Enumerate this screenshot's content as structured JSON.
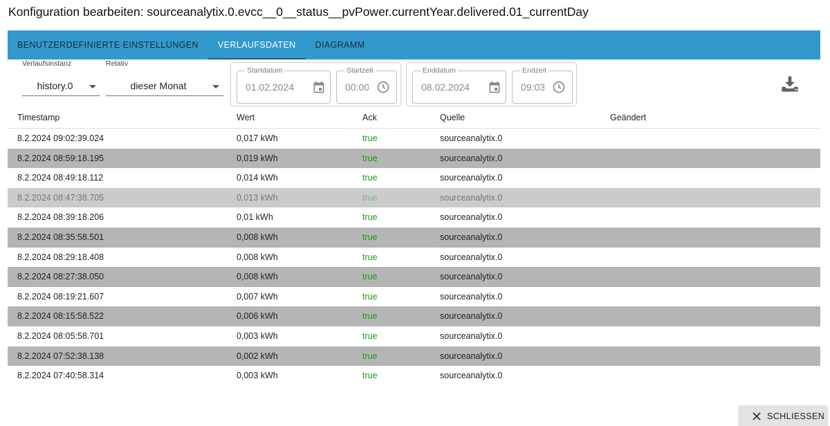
{
  "dialog": {
    "title": "Konfiguration bearbeiten: sourceanalytix.0.evcc__0__status__pvPower.currentYear.delivered.01_currentDay",
    "close_label": "SCHLIESSEN"
  },
  "tabs": [
    {
      "label": "BENUTZERDEFINIERTE EINSTELLUNGEN",
      "active": false
    },
    {
      "label": "VERLAUFSDATEN",
      "active": true
    },
    {
      "label": "DIAGRAMM",
      "active": false
    }
  ],
  "filters": {
    "instance": {
      "label": "Verlaufsinstanz",
      "value": "history.0"
    },
    "relative": {
      "label": "Relativ",
      "value": "dieser Monat"
    },
    "start_date": {
      "label": "Startdatum",
      "value": "01.02.2024"
    },
    "start_time": {
      "label": "Startzeit",
      "value": "00:00"
    },
    "end_date": {
      "label": "Enddatum",
      "value": "08.02.2024"
    },
    "end_time": {
      "label": "Endzeit",
      "value": "09:03"
    }
  },
  "table": {
    "columns": [
      "Timestamp",
      "Wert",
      "Ack",
      "Quelle",
      "Geändert"
    ],
    "rows": [
      {
        "timestamp": "8.2.2024 09:02:39.024",
        "value": "0,017 kWh",
        "ack": "true",
        "source": "sourceanalytix.0",
        "changed": ""
      },
      {
        "timestamp": "8.2.2024 08:59:18.195",
        "value": "0,019 kWh",
        "ack": "true",
        "source": "sourceanalytix.0",
        "changed": ""
      },
      {
        "timestamp": "8.2.2024 08:49:18.112",
        "value": "0,014 kWh",
        "ack": "true",
        "source": "sourceanalytix.0",
        "changed": ""
      },
      {
        "timestamp": "8.2.2024 08:47:38.705",
        "value": "0,013 kWh",
        "ack": "true",
        "source": "sourceanalytix.0",
        "changed": "",
        "highlighted": true
      },
      {
        "timestamp": "8.2.2024 08:39:18.206",
        "value": "0,01 kWh",
        "ack": "true",
        "source": "sourceanalytix.0",
        "changed": ""
      },
      {
        "timestamp": "8.2.2024 08:35:58.501",
        "value": "0,008 kWh",
        "ack": "true",
        "source": "sourceanalytix.0",
        "changed": ""
      },
      {
        "timestamp": "8.2.2024 08:29:18.408",
        "value": "0,008 kWh",
        "ack": "true",
        "source": "sourceanalytix.0",
        "changed": ""
      },
      {
        "timestamp": "8.2.2024 08:27:38.050",
        "value": "0,008 kWh",
        "ack": "true",
        "source": "sourceanalytix.0",
        "changed": ""
      },
      {
        "timestamp": "8.2.2024 08:19:21.607",
        "value": "0,007 kWh",
        "ack": "true",
        "source": "sourceanalytix.0",
        "changed": ""
      },
      {
        "timestamp": "8.2.2024 08:15:58.522",
        "value": "0,006 kWh",
        "ack": "true",
        "source": "sourceanalytix.0",
        "changed": ""
      },
      {
        "timestamp": "8.2.2024 08:05:58.701",
        "value": "0,003 kWh",
        "ack": "true",
        "source": "sourceanalytix.0",
        "changed": ""
      },
      {
        "timestamp": "8.2.2024 07:52:38.138",
        "value": "0,002 kWh",
        "ack": "true",
        "source": "sourceanalytix.0",
        "changed": ""
      },
      {
        "timestamp": "8.2.2024 07:40:58.314",
        "value": "0,003 kWh",
        "ack": "true",
        "source": "sourceanalytix.0",
        "changed": ""
      }
    ]
  },
  "icons": {
    "calendar": "calendar-icon",
    "clock": "clock-icon",
    "download": "download-icon",
    "close": "close-icon"
  },
  "colors": {
    "tabbar": "#3399cc",
    "ack_true": "#11a011",
    "stripe": "#b5b5b5"
  }
}
